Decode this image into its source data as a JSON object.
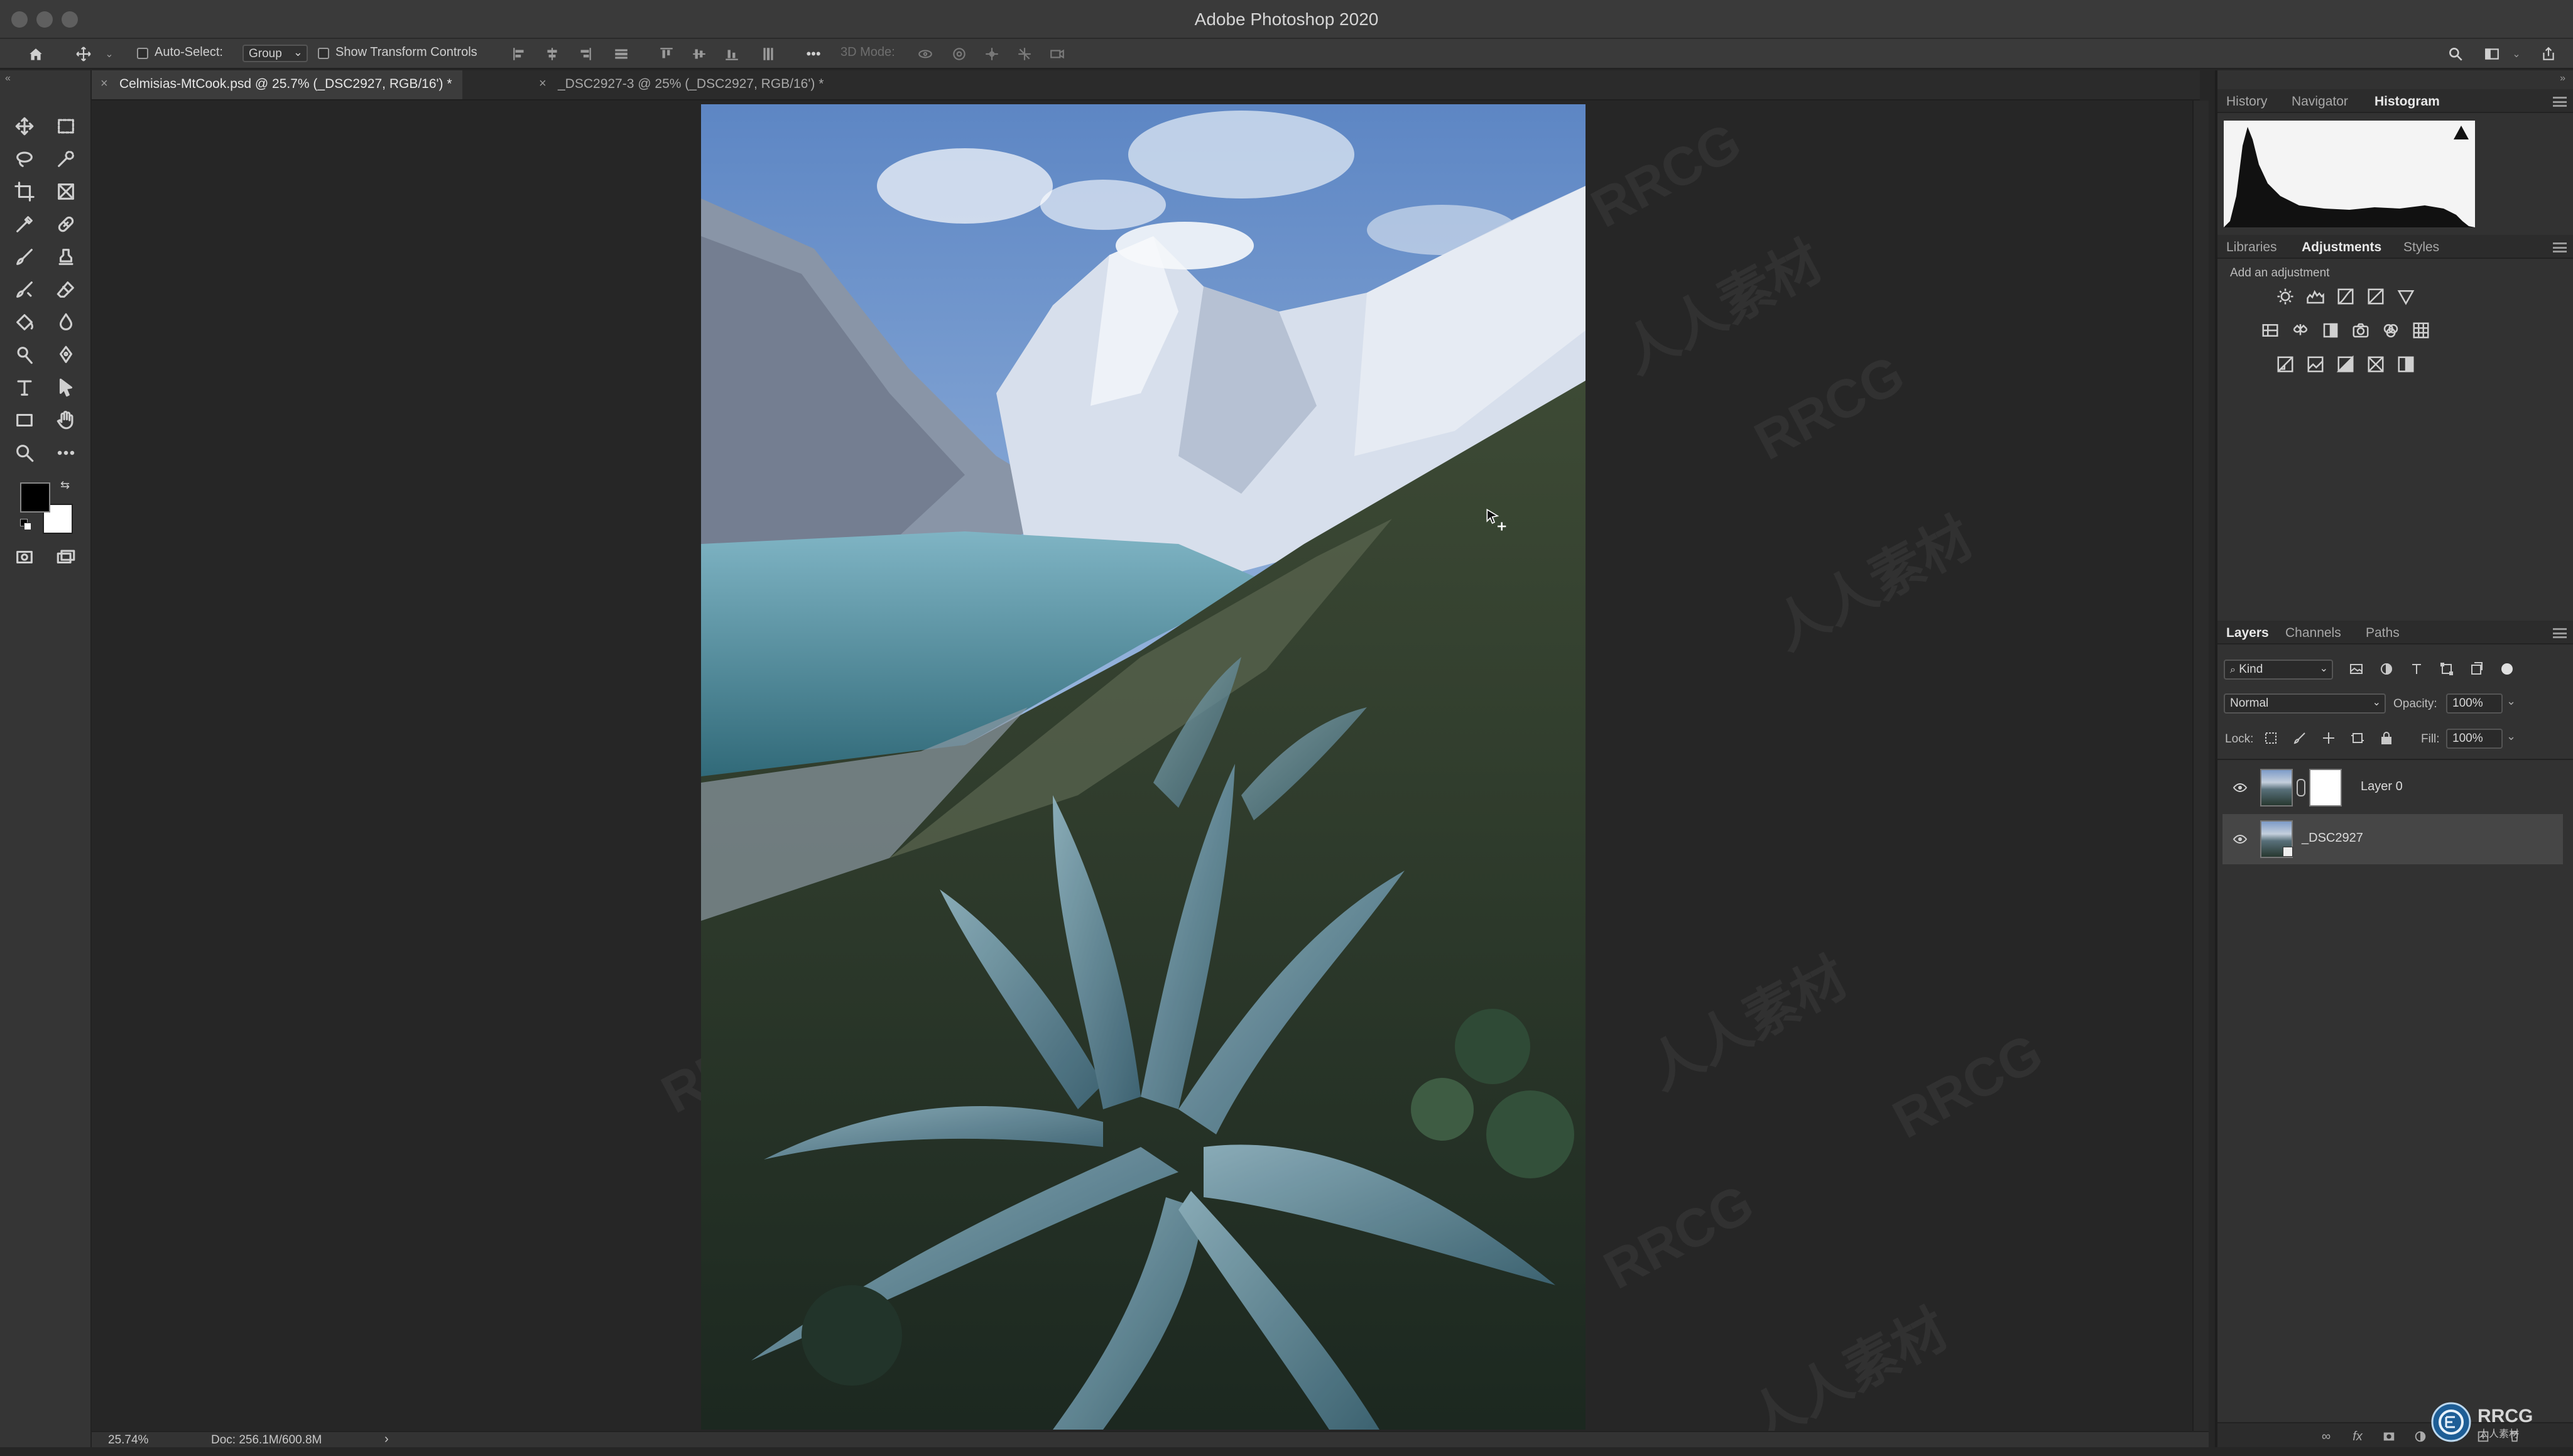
{
  "app": {
    "title": "Adobe Photoshop 2020"
  },
  "options_bar": {
    "auto_select_label": "Auto-Select:",
    "auto_select_value": "Group",
    "transform_label": "Show Transform Controls",
    "three_d_label": "3D Mode:"
  },
  "tabs": [
    {
      "label": "Celmisias-MtCook.psd @ 25.7% (_DSC2927, RGB/16') *"
    },
    {
      "label": "_DSC2927-3 @ 25% (_DSC2927, RGB/16') *"
    }
  ],
  "status": {
    "zoom": "25.74%",
    "doc": "Doc: 256.1M/600.8M"
  },
  "panels": {
    "top_tabs": [
      "History",
      "Navigator",
      "Histogram"
    ],
    "mid_tabs": [
      "Libraries",
      "Adjustments",
      "Styles"
    ],
    "adjust_hint": "Add an adjustment",
    "layer_tabs": [
      "Layers",
      "Channels",
      "Paths"
    ],
    "kind_label": "Kind",
    "blend_mode": "Normal",
    "opacity_label": "Opacity:",
    "opacity_value": "100%",
    "lock_label": "Lock:",
    "fill_label": "Fill:",
    "fill_value": "100%",
    "layers": [
      {
        "name": "Layer 0"
      },
      {
        "name": "_DSC2927"
      }
    ]
  },
  "watermarks": [
    "RRCG",
    "人人素材"
  ],
  "icons": {
    "tools": [
      "move-icon",
      "marquee-icon",
      "lasso-icon",
      "quick-select-icon",
      "crop-icon",
      "frame-icon",
      "eyedropper-icon",
      "healing-icon",
      "brush-icon",
      "stamp-icon",
      "history-brush-icon",
      "eraser-icon",
      "bucket-icon",
      "blur-icon",
      "dodge-icon",
      "pen-icon",
      "type-icon",
      "path-select-icon",
      "rectangle-icon",
      "hand-icon",
      "zoom-icon",
      "more-icon"
    ]
  },
  "colors": {
    "accent": "#2d8ceb",
    "panel_bg": "#323232",
    "canvas_bg": "#262626"
  }
}
